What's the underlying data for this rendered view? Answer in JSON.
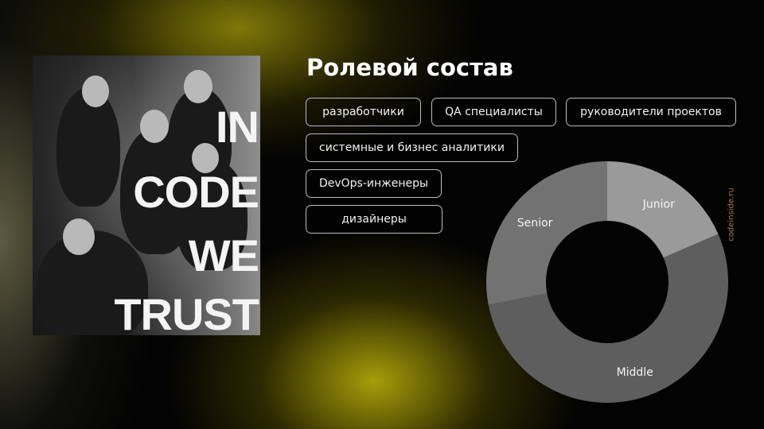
{
  "slide": {
    "title": "Ролевой состав",
    "site": "codeinside.ru",
    "photo_words": [
      "IN",
      "CODE",
      "WE",
      "TRUST"
    ],
    "roles": [
      "разработчики",
      "QA специалисты",
      "руководители проектов",
      "системные и бизнес аналитики",
      "DevOps-инженеры",
      "дизайнеры"
    ]
  },
  "chart_data": {
    "type": "pie",
    "title": "",
    "donut": true,
    "slices": [
      {
        "label": "Junior",
        "value": 18.5,
        "color": "#9a9a9a"
      },
      {
        "label": "Middle",
        "value": 53.5,
        "color": "#5e5e5e"
      },
      {
        "label": "Senior",
        "value": 28.0,
        "color": "#727272"
      }
    ]
  }
}
